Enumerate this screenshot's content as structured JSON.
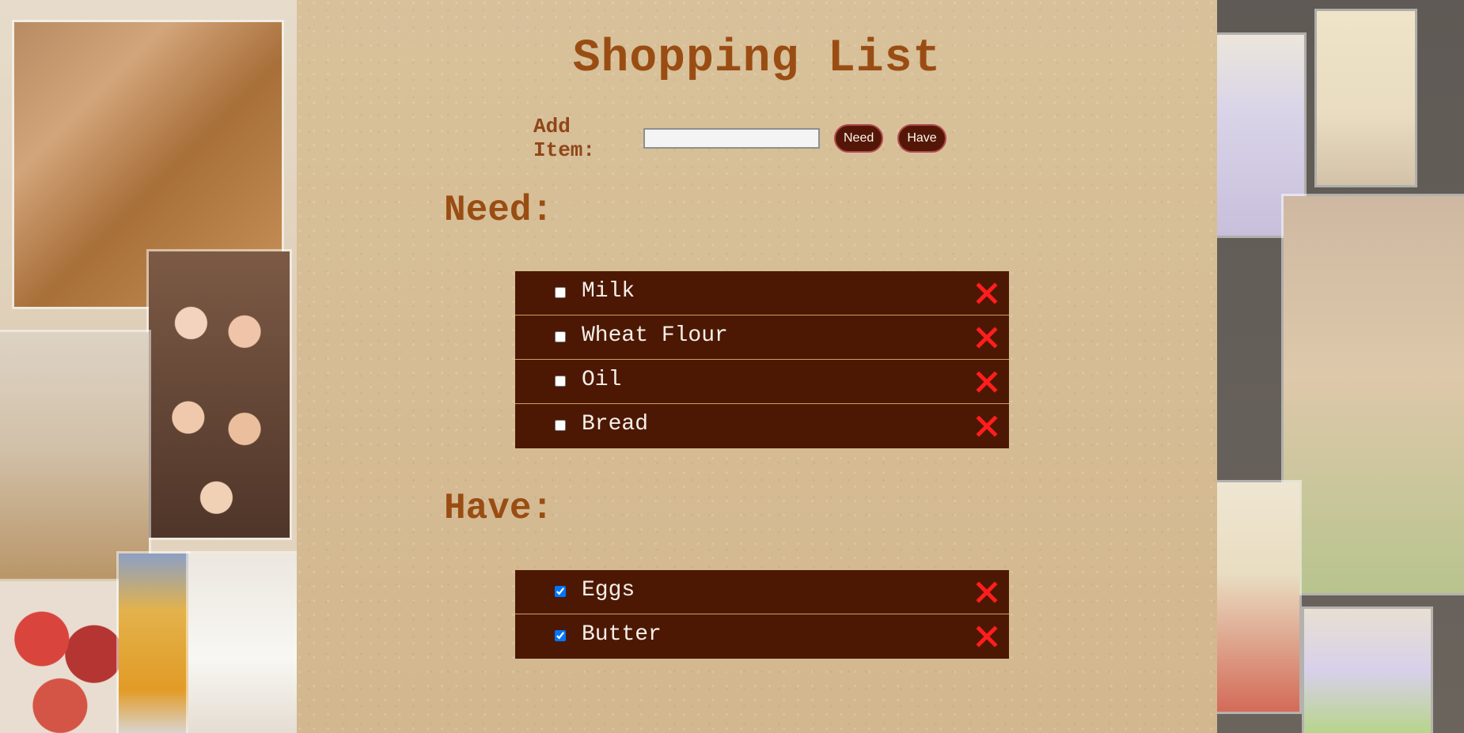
{
  "header": {
    "title": "Shopping List"
  },
  "add_item": {
    "label": "Add Item:",
    "value": "",
    "placeholder": "",
    "need_button": "Need",
    "have_button": "Have"
  },
  "need_section": {
    "title": "Need:",
    "items": [
      {
        "label": "Milk",
        "checked": false
      },
      {
        "label": "Wheat Flour",
        "checked": false
      },
      {
        "label": "Oil",
        "checked": false
      },
      {
        "label": "Bread",
        "checked": false
      }
    ]
  },
  "have_section": {
    "title": "Have:",
    "items": [
      {
        "label": "Eggs",
        "checked": true
      },
      {
        "label": "Butter",
        "checked": true
      }
    ]
  },
  "theme": {
    "accent": "#9a4d13",
    "row_bg": "#4c1803",
    "remove": "#ff1d1d"
  }
}
